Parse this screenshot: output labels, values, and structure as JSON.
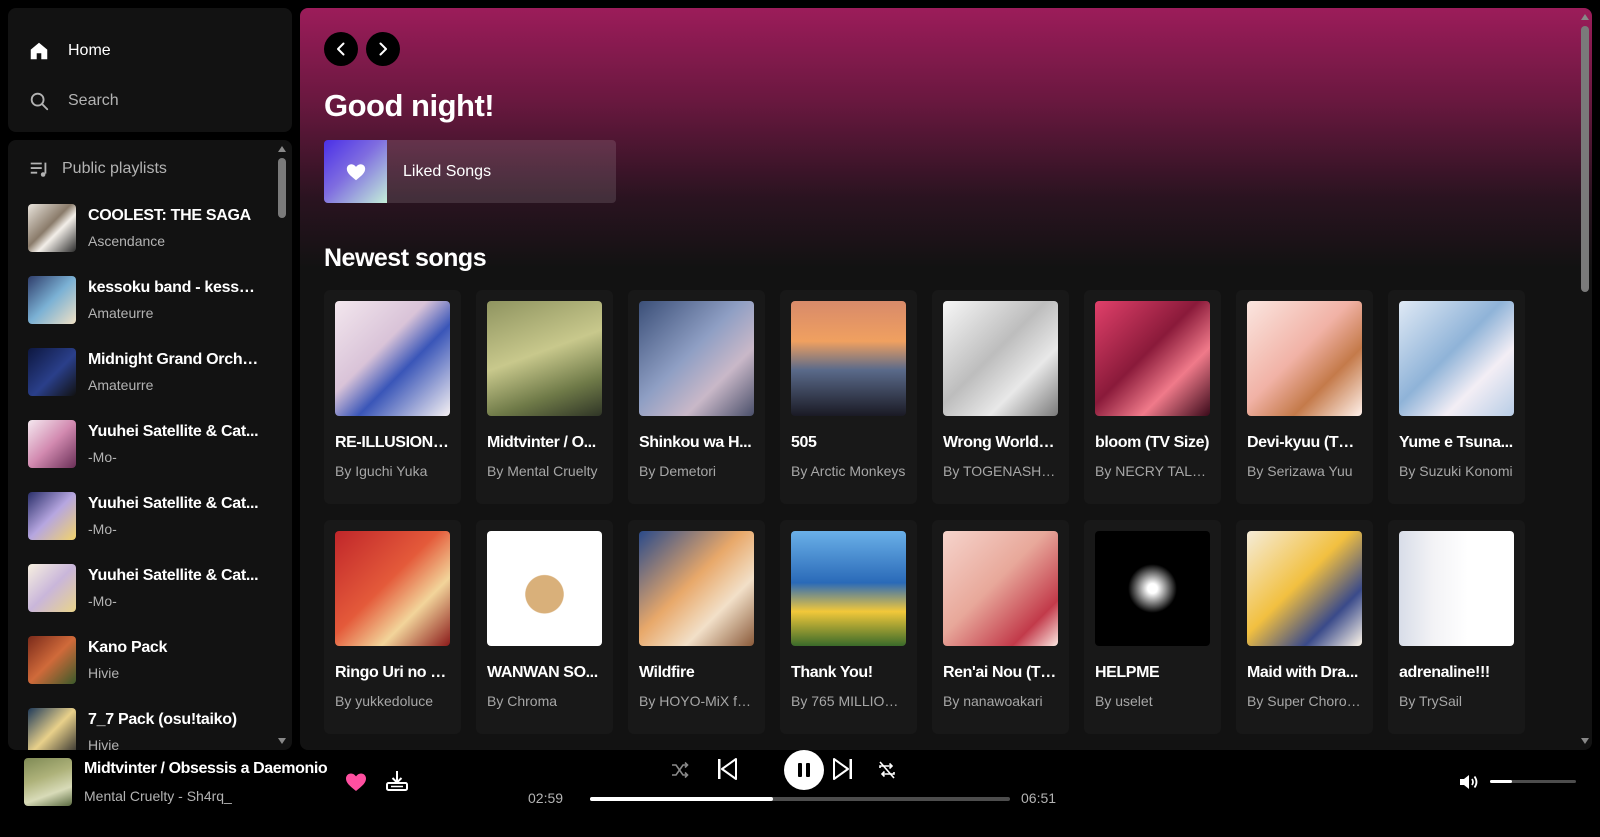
{
  "sidebar": {
    "nav": [
      {
        "label": "Home",
        "icon": "home-icon"
      },
      {
        "label": "Search",
        "icon": "search-icon"
      }
    ],
    "library_title": "Public playlists",
    "playlists": [
      {
        "title": "COOLEST: THE SAGA",
        "sub": "Ascendance",
        "art": "linear-gradient(135deg,#e9e4dc,#8a7b6a 45%,#f3efe9 60%,#2b2b2b)"
      },
      {
        "title": "kessoku band - kesso...",
        "sub": "Amateurre",
        "art": "linear-gradient(135deg,#2f3d6b,#7bb1d4 50%,#f0e1c5)"
      },
      {
        "title": "Midnight Grand Orche...",
        "sub": "Amateurre",
        "art": "linear-gradient(135deg,#0d1740,#2a3f8a 55%,#111)"
      },
      {
        "title": "Yuuhei Satellite & Cat...",
        "sub": "-Mo-",
        "art": "linear-gradient(135deg,#f5e9f0,#d28ab0 50%,#6a2f57)"
      },
      {
        "title": "Yuuhei Satellite & Cat...",
        "sub": "-Mo-",
        "art": "linear-gradient(135deg,#2a2f6a,#b6a6e0 50%,#f2d36b)"
      },
      {
        "title": "Yuuhei Satellite & Cat...",
        "sub": "-Mo-",
        "art": "linear-gradient(135deg,#f7f0e0,#c9b6da 50%,#e9d48a)"
      },
      {
        "title": "Kano Pack",
        "sub": "Hivie",
        "art": "linear-gradient(135deg,#7a2a1a,#d06a3a 50%,#3a5a2a)"
      },
      {
        "title": "7_7 Pack (osu!taiko)",
        "sub": "Hivie",
        "art": "linear-gradient(135deg,#1f3a5a,#e8d08a 50%,#2a2a2a)"
      }
    ]
  },
  "main": {
    "greeting": "Good night!",
    "liked_songs": "Liked Songs",
    "section_title": "Newest songs",
    "songs": [
      {
        "title": "RE-ILLUSION (...",
        "artist": "By Iguchi Yuka",
        "art": "linear-gradient(135deg,#f3e7ee,#d9c3d8 40%,#3a56b8 60%,#f5f0f2)"
      },
      {
        "title": "Midtvinter / O...",
        "artist": "By Mental Cruelty",
        "art": "linear-gradient(160deg,#8f9460,#c8c88c 45%,#6f7a48 75%,#2f3526)"
      },
      {
        "title": "Shinkou wa H...",
        "artist": "By Demetori",
        "art": "linear-gradient(135deg,#3b4f78,#8f9fc4 45%,#c9b8c8 70%,#4a4f6a)"
      },
      {
        "title": "505",
        "artist": "By Arctic Monkeys",
        "art": "linear-gradient(180deg,#d88a6a,#f0a060 35%,#5a6a8a 60%,#1a1a24)"
      },
      {
        "title": "Wrong World (...",
        "artist": "By TOGENASHI T...",
        "art": "linear-gradient(135deg,#f7f7f7,#bdbdbd 45%,#e8e8e8 70%,#7a7a7a)"
      },
      {
        "title": "bloom (TV Size)",
        "artist": "By NECRY TALKIE",
        "art": "linear-gradient(135deg,#e0406a,#8a1a3a 45%,#f07a8a 70%,#3a0a1a)"
      },
      {
        "title": "Devi-kyuu (TV ...",
        "artist": "By Serizawa Yuu",
        "art": "linear-gradient(135deg,#fbe6e0,#f1b2a6 45%,#c47a4a 70%,#fff1ea)"
      },
      {
        "title": "Yume e Tsuna...",
        "artist": "By Suzuki Konomi",
        "art": "linear-gradient(135deg,#dfe9f5,#8fb3d8 45%,#f3eef5 70%,#b8cde6)"
      },
      {
        "title": "Ringo Uri no U...",
        "artist": "By yukkedoluce",
        "art": "linear-gradient(135deg,#c0262a,#e45a3a 45%,#f2d49a 70%,#8a1a1a)"
      },
      {
        "title": "WANWAN SO...",
        "artist": "By Chroma",
        "art": "radial-gradient(circle at 50% 55%,#d9b07a 0 22%,#ffffff 23%)"
      },
      {
        "title": "Wildfire",
        "artist": "By HOYO-MiX fe...",
        "art": "linear-gradient(135deg,#2a4a8a,#e8a86a 45%,#f2e0c8 70%,#8a5a3a)"
      },
      {
        "title": "Thank You!",
        "artist": "By 765 MILLION...",
        "art": "linear-gradient(180deg,#6ab0e8,#2a6ab8 45%,#f2c83a 70%,#3a6a2a)"
      },
      {
        "title": "Ren'ai Nou (TV...",
        "artist": "By nanawoakari",
        "art": "linear-gradient(135deg,#f6d4cc,#e8a89a 45%,#c23a4a 80%,#fbe6e0)"
      },
      {
        "title": "HELPME",
        "artist": "By uselet",
        "art": "radial-gradient(circle at 50% 50%,#ffffff 0 6%,#000000 30%)"
      },
      {
        "title": "Maid with Dra...",
        "artist": "By Super Chorog...",
        "art": "linear-gradient(135deg,#f5ecd8,#f2c040 45%,#3a4a8a 75%,#fff7ea)"
      },
      {
        "title": "adrenaline!!!",
        "artist": "By TrySail",
        "art": "linear-gradient(90deg,#d8dde8,#f3f3f6 30%,#ffffff 60%)"
      }
    ]
  },
  "player": {
    "track_title": "Midtvinter / Obsessis a Daemonio",
    "track_artist": "Mental Cruelty - Sh4rq_",
    "current_time": "02:59",
    "duration": "06:51",
    "progress_fraction": 0.436,
    "volume_fraction": 0.25,
    "is_playing": true,
    "liked": true
  },
  "colors": {
    "accent_pink": "#ff4fa0",
    "header_gradient": "#9c1c5a",
    "surface": "#121212",
    "card": "#181818"
  }
}
